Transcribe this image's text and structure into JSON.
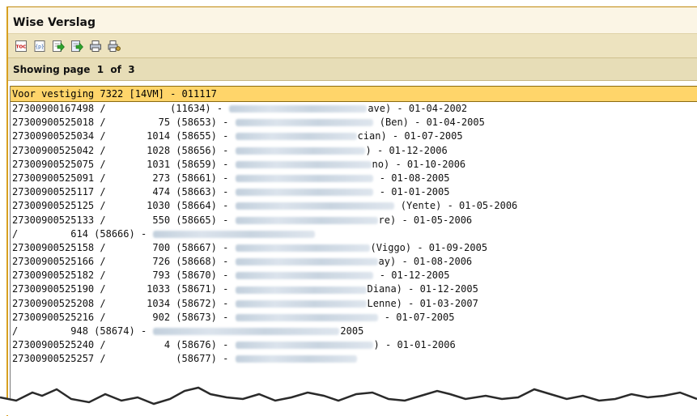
{
  "window": {
    "title": "Wise Verslag"
  },
  "toolbar": {
    "buttons": [
      {
        "name": "toc-icon",
        "glyph": "TOC"
      },
      {
        "name": "page-number-icon",
        "glyph": "{p}"
      },
      {
        "name": "export-icon",
        "glyph": ""
      },
      {
        "name": "export-all-icon",
        "glyph": ""
      },
      {
        "name": "print-icon",
        "glyph": ""
      },
      {
        "name": "print-setup-icon",
        "glyph": ""
      }
    ]
  },
  "pager": {
    "text": "Showing page  1  of  3"
  },
  "report": {
    "header": "Voor vestiging 7322 [14VM] - 011117",
    "rows": [
      {
        "pre": "27300900167498 /           (11634) - ",
        "blur": 170,
        "post": "ave) - 01-04-2002"
      },
      {
        "pre": "27300900525018 /         75 (58653) - ",
        "blur": 170,
        "post": " (Ben) - 01-04-2005"
      },
      {
        "pre": "27300900525034 /       1014 (58655) - ",
        "blur": 150,
        "post": "cian) - 01-07-2005"
      },
      {
        "pre": "27300900525042 /       1028 (58656) - ",
        "blur": 160,
        "post": ") - 01-12-2006"
      },
      {
        "pre": "27300900525075 /       1031 (58659) - ",
        "blur": 168,
        "post": "no) - 01-10-2006"
      },
      {
        "pre": "27300900525091 /        273 (58661) - ",
        "blur": 170,
        "post": " - 01-08-2005"
      },
      {
        "pre": "27300900525117 /        474 (58663) - ",
        "blur": 170,
        "post": " - 01-01-2005"
      },
      {
        "pre": "27300900525125 /       1030 (58664) - ",
        "blur": 196,
        "post": " (Yente) - 01-05-2006"
      },
      {
        "pre": "27300900525133 /        550 (58665) - ",
        "blur": 176,
        "post": "re) - 01-05-2006"
      },
      {
        "pre": "/         614 (58666) - ",
        "blur": 200,
        "post": ""
      },
      {
        "pre": "27300900525158 /        700 (58667) - ",
        "blur": 166,
        "post": "(Viggo) - 01-09-2005"
      },
      {
        "pre": "27300900525166 /        726 (58668) - ",
        "blur": 176,
        "post": "ay) - 01-08-2006"
      },
      {
        "pre": "27300900525182 /        793 (58670) - ",
        "blur": 170,
        "post": " - 01-12-2005"
      },
      {
        "pre": "27300900525190 /       1033 (58671) - ",
        "blur": 162,
        "post": "Diana) - 01-12-2005"
      },
      {
        "pre": "27300900525208 /       1034 (58672) - ",
        "blur": 162,
        "post": "Lenne) - 01-03-2007"
      },
      {
        "pre": "27300900525216 /        902 (58673) - ",
        "blur": 176,
        "post": " - 01-07-2005"
      },
      {
        "pre": "/         948 (58674) - ",
        "blur": 230,
        "post": "2005"
      },
      {
        "pre": "27300900525240 /          4 (58676) - ",
        "blur": 170,
        "post": ") - 01-01-2006"
      },
      {
        "pre": "27300900525257 /            (58677) - ",
        "blur": 150,
        "post": ""
      }
    ]
  }
}
